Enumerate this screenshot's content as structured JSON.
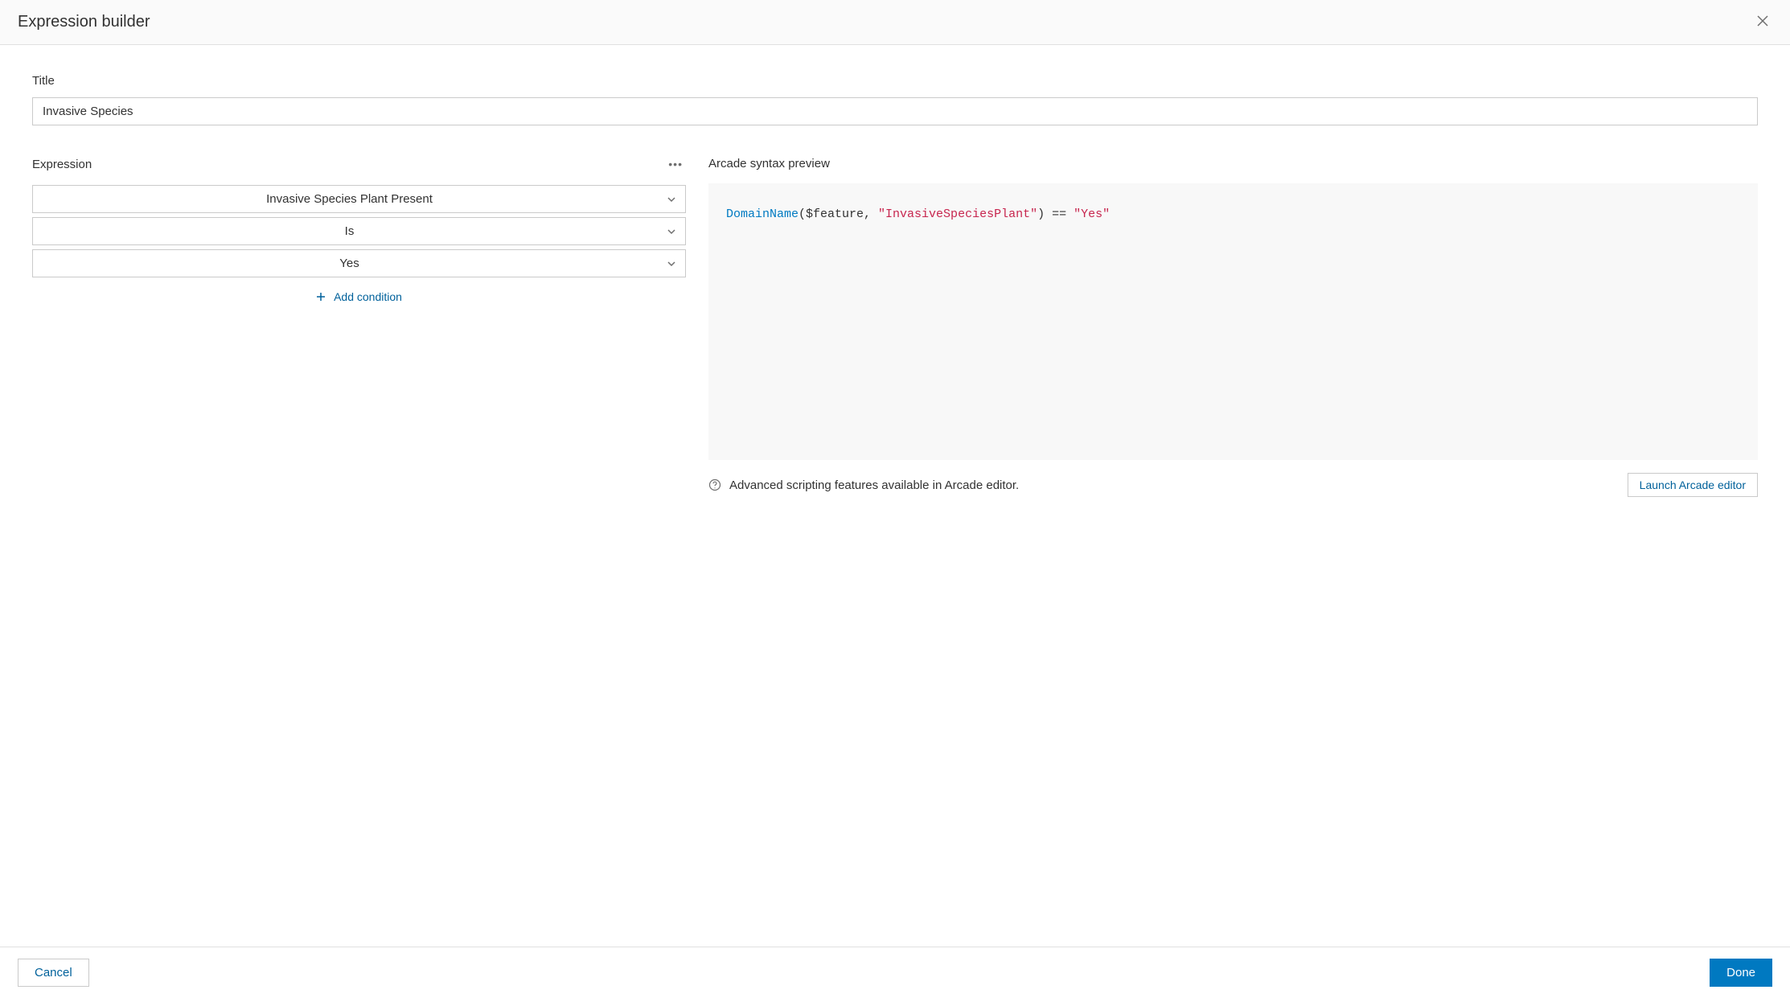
{
  "header": {
    "title": "Expression builder"
  },
  "title_section": {
    "label": "Title",
    "value": "Invasive Species"
  },
  "expression_section": {
    "label": "Expression",
    "field_select": "Invasive Species Plant Present",
    "operator_select": "Is",
    "value_select": "Yes",
    "add_condition_label": "Add condition"
  },
  "preview_section": {
    "label": "Arcade syntax preview",
    "code": {
      "fn": "DomainName",
      "open": "($feature, ",
      "str1": "\"InvasiveSpeciesPlant\"",
      "mid": ") == ",
      "str2": "\"Yes\""
    },
    "hint_text": "Advanced scripting features available in Arcade editor.",
    "launch_label": "Launch Arcade editor"
  },
  "footer": {
    "cancel_label": "Cancel",
    "done_label": "Done"
  }
}
